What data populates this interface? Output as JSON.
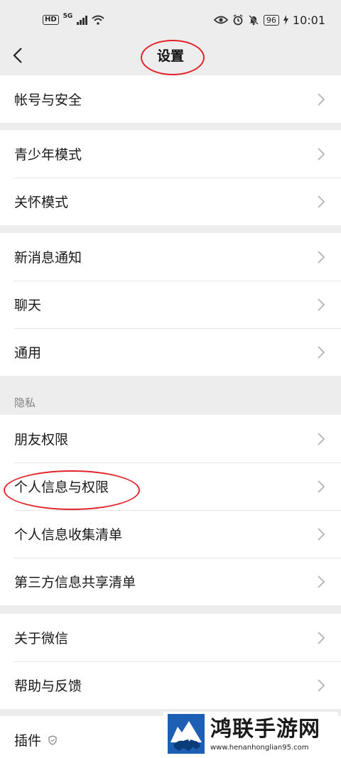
{
  "status_bar": {
    "hd": "HD",
    "network": "5G",
    "battery": "96",
    "time": "10:01"
  },
  "nav": {
    "title": "设置"
  },
  "groups": [
    {
      "items": [
        "帐号与安全"
      ]
    },
    {
      "items": [
        "青少年模式",
        "关怀模式"
      ]
    },
    {
      "items": [
        "新消息通知",
        "聊天",
        "通用"
      ]
    },
    {
      "label": "隐私",
      "items": [
        "朋友权限",
        "个人信息与权限",
        "个人信息收集清单",
        "第三方信息共享清单"
      ]
    },
    {
      "items": [
        "关于微信",
        "帮助与反馈"
      ]
    },
    {
      "items": [
        "插件"
      ]
    }
  ],
  "annotation_color": "#e2232a",
  "watermark": {
    "title": "鸿联手游网",
    "url": "www.henanhonglian95.com"
  }
}
